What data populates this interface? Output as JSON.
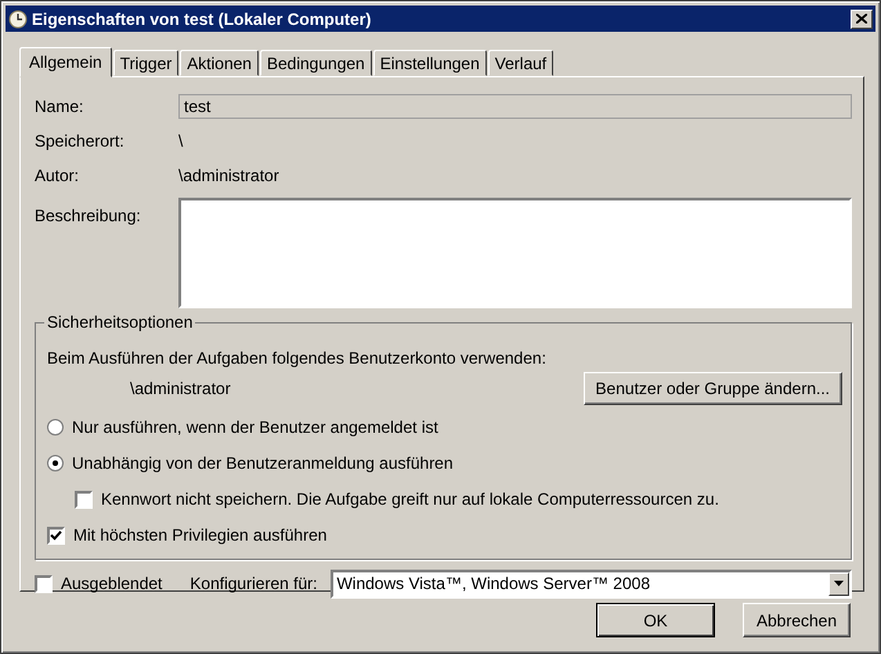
{
  "window": {
    "title": "Eigenschaften von test (Lokaler Computer)"
  },
  "tabs": [
    {
      "label": "Allgemein",
      "selected": true
    },
    {
      "label": "Trigger",
      "selected": false
    },
    {
      "label": "Aktionen",
      "selected": false
    },
    {
      "label": "Bedingungen",
      "selected": false
    },
    {
      "label": "Einstellungen",
      "selected": false
    },
    {
      "label": "Verlauf",
      "selected": false
    }
  ],
  "fields": [
    {
      "label": "Name:",
      "kind": "input",
      "value": "test"
    },
    {
      "label": "Speicherort:",
      "kind": "text",
      "value": "\\"
    },
    {
      "label": "Autor:",
      "kind": "text",
      "value": "\\administrator"
    },
    {
      "label": "Beschreibung:",
      "kind": "textarea"
    }
  ],
  "security": {
    "title": "Sicherheitsoptionen",
    "prompt": "Beim Ausführen der Aufgaben folgendes Benutzerkonto verwenden:",
    "account": "\\administrator",
    "change_button": "Benutzer oder Gruppe ändern...",
    "options": [
      {
        "kind": "radio",
        "label": "Nur ausführen, wenn der Benutzer angemeldet ist",
        "selected": false
      },
      {
        "kind": "radio",
        "label": "Unabhängig von der Benutzeranmeldung ausführen",
        "selected": true,
        "children": [
          {
            "kind": "checkbox",
            "label": "Kennwort nicht speichern. Die Aufgabe greift nur auf lokale Computerressourcen zu.",
            "checked": false
          }
        ]
      },
      {
        "kind": "checkbox",
        "label": "Mit höchsten Privilegien ausführen",
        "checked": true
      }
    ]
  },
  "hidden": {
    "label": "Ausgeblendet",
    "checked": false
  },
  "configure": {
    "label": "Konfigurieren für:",
    "value": "Windows Vista™, Windows Server™ 2008"
  },
  "buttons": [
    {
      "label": "OK",
      "default": true
    },
    {
      "label": "Abbrechen",
      "default": false
    }
  ]
}
